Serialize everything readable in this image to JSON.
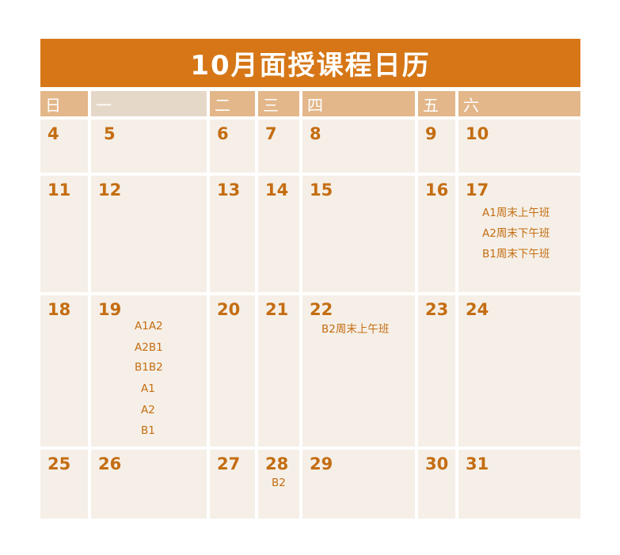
{
  "title": "10月面授课程日历",
  "weekdays": [
    "日",
    "一",
    "二",
    "三",
    "四",
    "五",
    "六"
  ],
  "weeks": [
    {
      "days": [
        "4",
        "5",
        "6",
        "7",
        "8",
        "9",
        "10"
      ]
    },
    {
      "days": [
        "11",
        "12",
        "13",
        "14",
        "15",
        "16",
        "17"
      ]
    },
    {
      "days": [
        "18",
        "19",
        "20",
        "21",
        "22",
        "23",
        "24"
      ]
    },
    {
      "days": [
        "25",
        "26",
        "27",
        "28",
        "29",
        "30",
        "31"
      ]
    }
  ],
  "events": {
    "oct17": [
      "A1周末上午班",
      "A2周末下午班",
      "B1周末下午班"
    ],
    "oct19": [
      "A1A2",
      "A2B1",
      "B1B2",
      "A1",
      "A2",
      "B1"
    ],
    "oct22": [
      "B2周末上午班"
    ],
    "oct28": [
      "B2"
    ]
  },
  "colors": {
    "title_bg": "#d67616",
    "header_tan": "#e3b78a",
    "header_pale": "#e6d8c8",
    "cell_bg": "#f5efe7",
    "text": "#c46d12"
  }
}
